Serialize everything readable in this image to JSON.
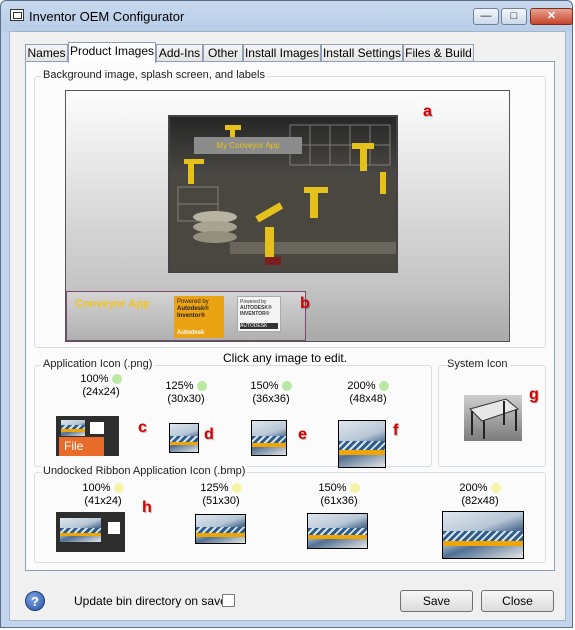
{
  "window": {
    "title": "Inventor OEM Configurator"
  },
  "tabs": [
    {
      "label": "Names",
      "active": false
    },
    {
      "label": "Product Images",
      "active": true
    },
    {
      "label": "Add-Ins",
      "active": false
    },
    {
      "label": "Other",
      "active": false
    },
    {
      "label": "Install Images",
      "active": false
    },
    {
      "label": "Install Settings",
      "active": false
    },
    {
      "label": "Files & Build",
      "active": false
    }
  ],
  "background": {
    "group_title": "Background image, splash screen, and labels",
    "splash_banner": "My Conveyor App",
    "app_name": "Conveyor App",
    "badge1": {
      "powered_by": "Powered by",
      "brand": "Autodesk® Inventor®",
      "footer": "Autodesk"
    },
    "badge2": {
      "powered_by": "Powered by",
      "brand": "AUTODESK® INVENTOR®",
      "footer": "AUTODESK"
    },
    "marker_a": "a",
    "marker_b": "b"
  },
  "hint": "Click any image to edit.",
  "app_icon": {
    "group_title": "Application Icon (.png)",
    "items": [
      {
        "percent": "100%",
        "size": "(24x24)",
        "marker": "c",
        "file_label": "File"
      },
      {
        "percent": "125%",
        "size": "(30x30)",
        "marker": "d"
      },
      {
        "percent": "150%",
        "size": "(36x36)",
        "marker": "e"
      },
      {
        "percent": "200%",
        "size": "(48x48)",
        "marker": "f"
      }
    ],
    "dot_color": "#b9e8a3"
  },
  "system_icon": {
    "group_title": "System Icon",
    "marker": "g"
  },
  "ribbon_icon": {
    "group_title": "Undocked Ribbon Application Icon (.bmp)",
    "items": [
      {
        "percent": "100%",
        "size": "(41x24)",
        "marker": "h"
      },
      {
        "percent": "125%",
        "size": "(51x30)"
      },
      {
        "percent": "150%",
        "size": "(61x36)"
      },
      {
        "percent": "200%",
        "size": "(82x48)"
      }
    ],
    "dot_color": "#f5f3a5"
  },
  "footer": {
    "help_label": "?",
    "update_label": "Update bin directory on save.",
    "update_checked": false,
    "save_label": "Save",
    "close_label": "Close"
  },
  "colors": {
    "accent_marker": "#d60000",
    "banner_text": "#f4c31a",
    "badge_orange": "#eba314"
  }
}
